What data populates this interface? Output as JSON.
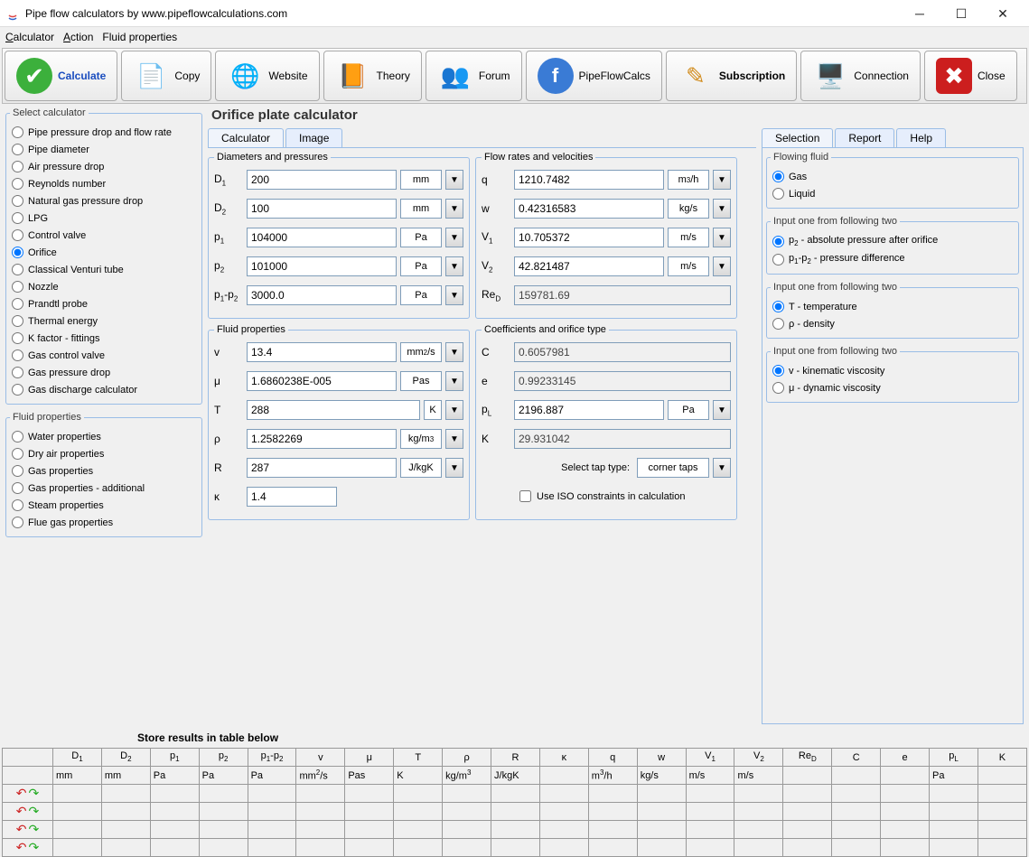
{
  "window": {
    "title": "Pipe flow calculators by www.pipeflowcalculations.com"
  },
  "menubar": {
    "calculator": "Calculator",
    "action": "Action",
    "fluid": "Fluid properties"
  },
  "toolbar": {
    "calculate": "Calculate",
    "copy": "Copy",
    "website": "Website",
    "theory": "Theory",
    "forum": "Forum",
    "pfc": "PipeFlowCalcs",
    "subscription": "Subscription",
    "connection": "Connection",
    "close": "Close"
  },
  "sidebar": {
    "select_calc_legend": "Select calculator",
    "calcs": [
      "Pipe pressure drop and flow rate",
      "Pipe diameter",
      "Air pressure drop",
      "Reynolds number",
      "Natural gas pressure drop",
      "LPG",
      "Control valve",
      "Orifice",
      "Classical Venturi tube",
      "Nozzle",
      "Prandtl probe",
      "Thermal energy",
      "K factor - fittings",
      "Gas control valve",
      "Gas pressure drop",
      "Gas discharge calculator"
    ],
    "selected_calc": "Orifice",
    "fluid_legend": "Fluid properties",
    "fluids": [
      "Water properties",
      "Dry air properties",
      "Gas properties",
      "Gas properties - additional",
      "Steam properties",
      "Flue gas properties"
    ]
  },
  "page_title": "Orifice plate calculator",
  "left_tabs": {
    "calculator": "Calculator",
    "image": "Image"
  },
  "right_tabs": {
    "selection": "Selection",
    "report": "Report",
    "help": "Help"
  },
  "panels": {
    "diam": {
      "legend": "Diameters and pressures",
      "D1": {
        "label": "D₁",
        "value": "200",
        "unit": "mm"
      },
      "D2": {
        "label": "D₂",
        "value": "100",
        "unit": "mm"
      },
      "p1": {
        "label": "p₁",
        "value": "104000",
        "unit": "Pa"
      },
      "p2": {
        "label": "p₂",
        "value": "101000",
        "unit": "Pa"
      },
      "dp": {
        "label": "p₁-p₂",
        "value": "3000.0",
        "unit": "Pa"
      }
    },
    "flow": {
      "legend": "Flow rates and velocities",
      "q": {
        "label": "q",
        "value": "1210.7482",
        "unit": "m³/h"
      },
      "w": {
        "label": "w",
        "value": "0.42316583",
        "unit": "kg/s"
      },
      "V1": {
        "label": "V₁",
        "value": "10.705372",
        "unit": "m/s"
      },
      "V2": {
        "label": "V₂",
        "value": "42.821487",
        "unit": "m/s"
      },
      "ReD": {
        "label": "Re_D",
        "value": "159781.69"
      }
    },
    "fluid": {
      "legend": "Fluid properties",
      "nu": {
        "label": "v",
        "value": "13.4",
        "unit": "mm²/s"
      },
      "mu": {
        "label": "μ",
        "value": "1.6860238E-005",
        "unit": "Pas"
      },
      "T": {
        "label": "T",
        "value": "288",
        "unit": "K"
      },
      "rho": {
        "label": "ρ",
        "value": "1.2582269",
        "unit": "kg/m³"
      },
      "R": {
        "label": "R",
        "value": "287",
        "unit": "J/kgK"
      },
      "k": {
        "label": "κ",
        "value": "1.4"
      }
    },
    "coef": {
      "legend": "Coefficients and orifice type",
      "C": {
        "label": "C",
        "value": "0.6057981"
      },
      "e": {
        "label": "e",
        "value": "0.99233145"
      },
      "pL": {
        "label": "p_L",
        "value": "2196.887",
        "unit": "Pa"
      },
      "K": {
        "label": "K",
        "value": "29.931042"
      },
      "tap_label": "Select tap type:",
      "tap_value": "corner taps",
      "iso_label": "Use ISO constraints in calculation"
    }
  },
  "selection": {
    "flowing_legend": "Flowing fluid",
    "gas": "Gas",
    "liquid": "Liquid",
    "grp2_legend": "Input one from following two",
    "p2_opt": "p₂ - absolute pressure after orifice",
    "dp_opt": "p₁-p₂ - pressure difference",
    "grp3_legend": "Input one from following two",
    "T_opt": "T - temperature",
    "rho_opt": "ρ - density",
    "grp4_legend": "Input one from following two",
    "nu_opt": "v - kinematic viscosity",
    "mu_opt": "μ - dynamic viscosity"
  },
  "table": {
    "heading": "Store results in table below",
    "headers1": [
      "",
      "D₁",
      "D₂",
      "p₁",
      "p₂",
      "p₁-p₂",
      "v",
      "μ",
      "T",
      "ρ",
      "R",
      "κ",
      "q",
      "w",
      "V₁",
      "V₂",
      "Re_D",
      "C",
      "e",
      "p_L",
      "K"
    ],
    "headers2": [
      "",
      "mm",
      "mm",
      "Pa",
      "Pa",
      "Pa",
      "mm²/s",
      "Pas",
      "K",
      "kg/m³",
      "J/kgK",
      "",
      "m³/h",
      "kg/s",
      "m/s",
      "m/s",
      "",
      "",
      "",
      "Pa",
      ""
    ]
  }
}
